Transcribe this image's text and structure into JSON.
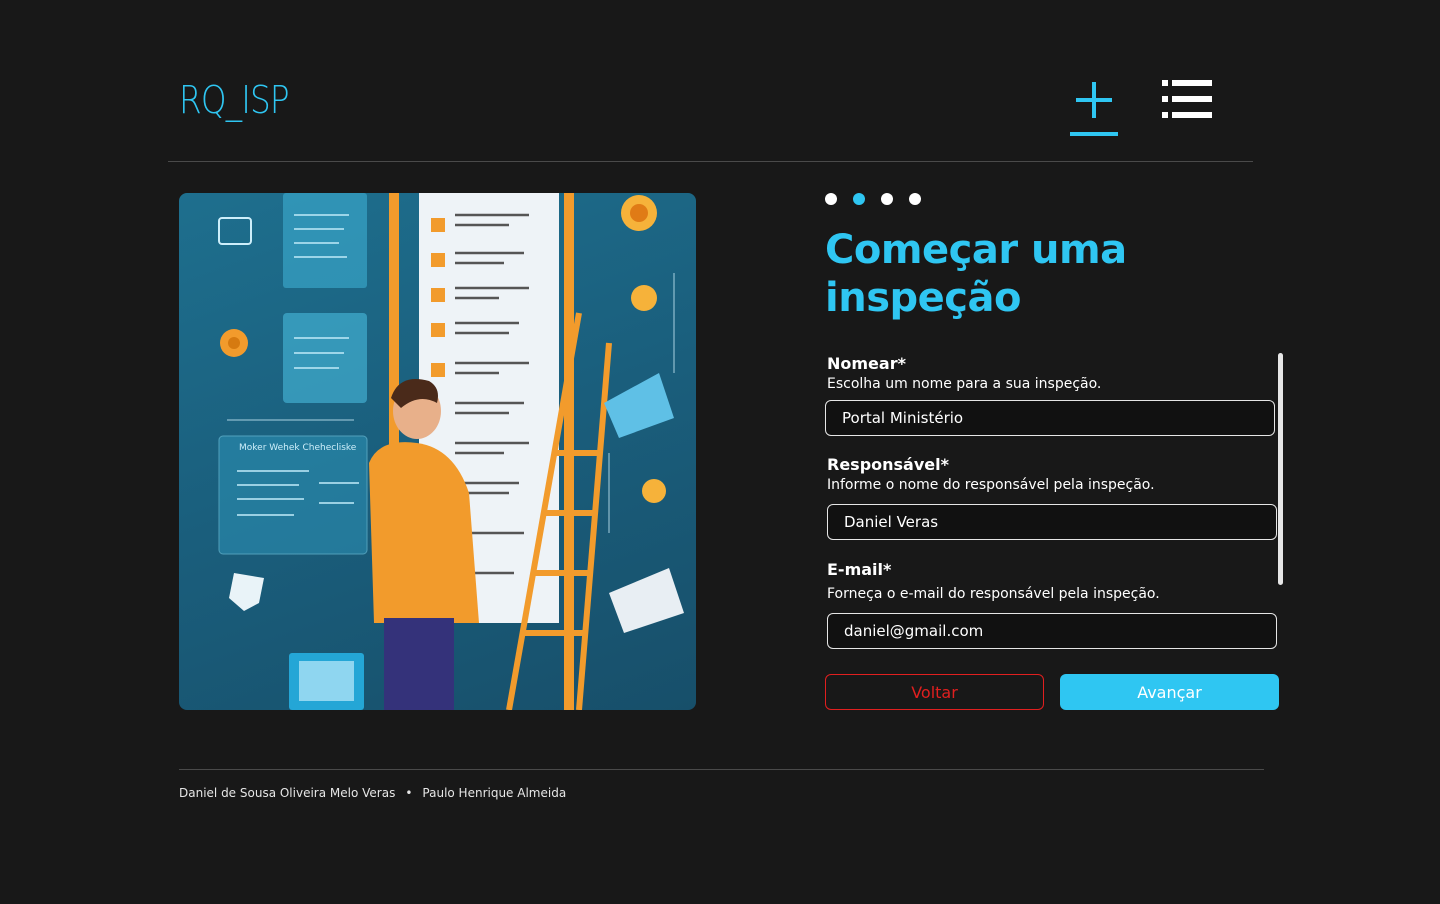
{
  "header": {
    "logo_text": "RQ_ISP",
    "nav": [
      {
        "icon": "plus-icon",
        "active": true
      },
      {
        "icon": "list-icon",
        "active": false
      }
    ]
  },
  "colors": {
    "accent": "#2fc6f2",
    "background": "#181818",
    "danger": "#e01f1f"
  },
  "progress": {
    "total_steps": 4,
    "current_step": 2
  },
  "form": {
    "title": "Começar uma inspeção",
    "fields": {
      "nome": {
        "label": "Nomear*",
        "hint": "Escolha um nome para a sua inspeção.",
        "value": "Portal Ministério"
      },
      "responsavel": {
        "label": "Responsável*",
        "hint": "Informe o nome do responsável pela inspeção.",
        "value": "Daniel Veras"
      },
      "email": {
        "label": "E-mail*",
        "hint": "Forneça o e-mail do responsável pela inspeção.",
        "value": "daniel@gmail.com"
      }
    },
    "back_label": "Voltar",
    "next_label": "Avançar"
  },
  "illustration": {
    "panel_label": "Moker Wehek Chehecliske"
  },
  "footer": {
    "author_1": "Daniel de Sousa Oliveira Melo Veras",
    "separator": "•",
    "author_2": "Paulo Henrique Almeida"
  }
}
